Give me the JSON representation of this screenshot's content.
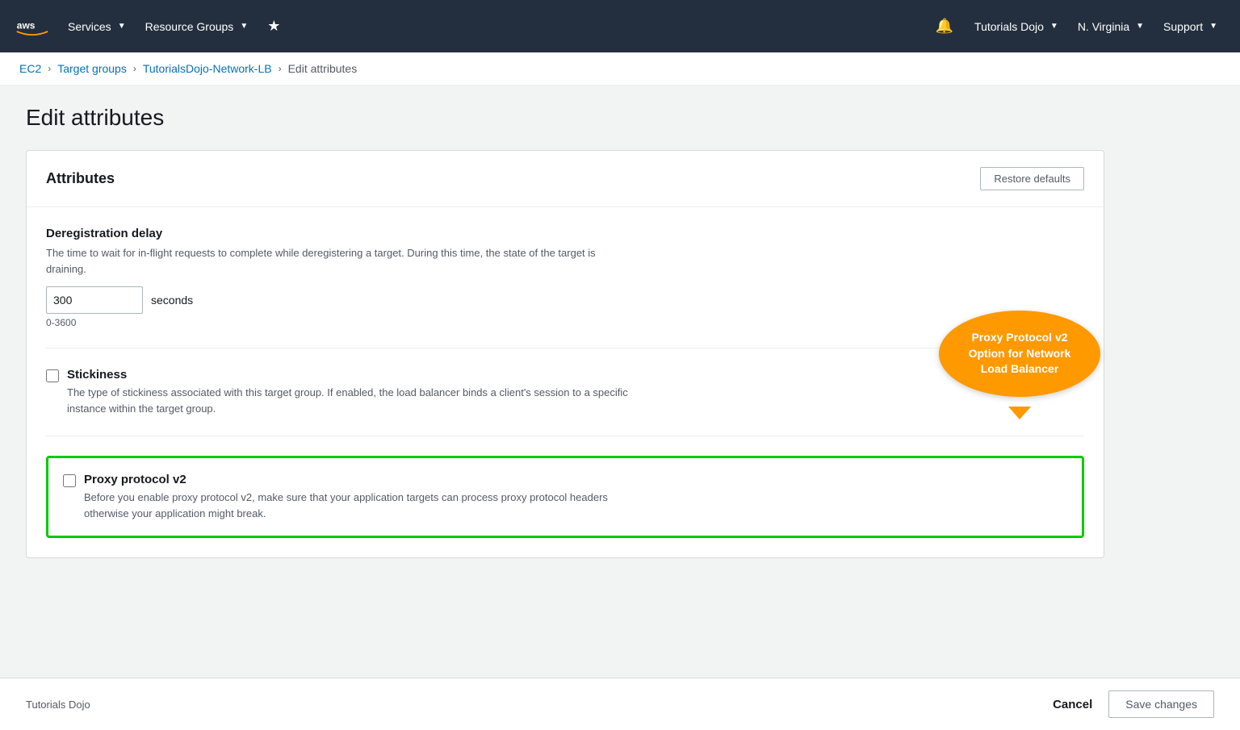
{
  "nav": {
    "services_label": "Services",
    "resource_groups_label": "Resource Groups",
    "tutorials_dojo_label": "Tutorials Dojo",
    "region_label": "N. Virginia",
    "support_label": "Support"
  },
  "breadcrumb": {
    "ec2": "EC2",
    "target_groups": "Target groups",
    "lb_name": "TutorialsDojo-Network-LB",
    "current": "Edit attributes"
  },
  "page": {
    "title": "Edit attributes"
  },
  "card": {
    "title": "Attributes",
    "restore_btn": "Restore defaults"
  },
  "deregistration": {
    "title": "Deregistration delay",
    "desc": "The time to wait for in-flight requests to complete while deregistering a target. During this time, the state of the target is draining.",
    "value": "300",
    "unit": "seconds",
    "hint": "0-3600"
  },
  "stickiness": {
    "title": "Stickiness",
    "desc": "The type of stickiness associated with this target group. If enabled, the load balancer binds a client's session to a specific instance within the target group."
  },
  "proxy_protocol": {
    "title": "Proxy protocol v2",
    "desc": "Before you enable proxy protocol v2, make sure that your application targets can process proxy protocol headers otherwise your application might break.",
    "bubble_text": "Proxy Protocol v2 Option for Network Load Balancer"
  },
  "footer": {
    "brand": "Tutorials Dojo",
    "cancel": "Cancel",
    "save": "Save changes"
  }
}
